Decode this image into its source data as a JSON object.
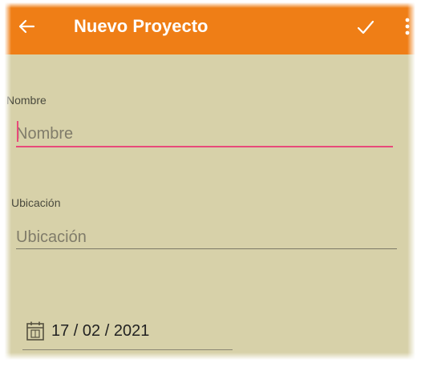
{
  "appbar": {
    "title": "Nuevo Proyecto",
    "back_icon": "arrow-left-icon",
    "confirm_icon": "check-icon",
    "menu_icon": "more-vert-icon",
    "color": "#ef7e16"
  },
  "form": {
    "name_label": "Nombre",
    "name_placeholder": "Nombre",
    "location_label": "Ubicación",
    "location_placeholder": "Ubicación",
    "date_icon": "calendar-icon",
    "date_value": "17 / 02 / 2021"
  },
  "colors": {
    "background": "#d7d1a9",
    "focus_underline": "#e84a7a"
  }
}
